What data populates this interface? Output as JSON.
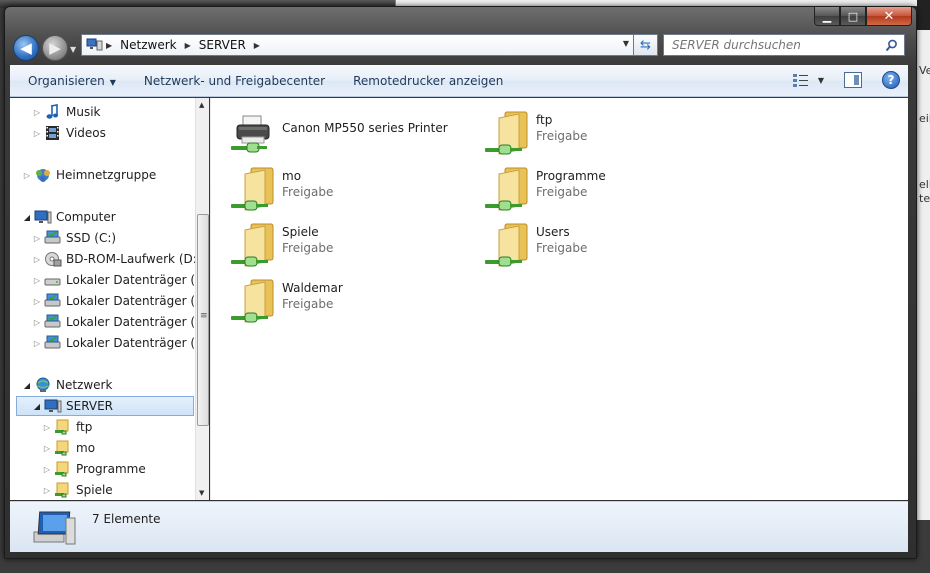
{
  "window": {
    "caption_buttons": {
      "minimize": "▁",
      "maximize": "□",
      "close": "✕"
    }
  },
  "address": {
    "crumbs": [
      "Netzwerk",
      "SERVER"
    ],
    "search_placeholder": "SERVER durchsuchen"
  },
  "toolbar": {
    "organize": "Organisieren",
    "network_center": "Netzwerk- und Freigabecenter",
    "remote_printers": "Remotedrucker anzeigen"
  },
  "nav": {
    "items": [
      {
        "label": "Musik",
        "icon": "music-icon",
        "toggle": "▷"
      },
      {
        "label": "Videos",
        "icon": "video-icon",
        "toggle": "▷"
      },
      {
        "label": "Heimnetzgruppe",
        "icon": "homegroup-icon",
        "toggle": "▷"
      },
      {
        "label": "Computer",
        "icon": "computer-icon",
        "toggle": "◢"
      },
      {
        "label": "SSD (C:)",
        "icon": "drive-icon",
        "toggle": "▷"
      },
      {
        "label": "BD-ROM-Laufwerk (D:) BD-ROM",
        "icon": "disc-icon",
        "toggle": "▷"
      },
      {
        "label": "Lokaler Datenträger (E:)",
        "icon": "drive-icon",
        "toggle": "▷"
      },
      {
        "label": "Lokaler Datenträger (X:)",
        "icon": "drive-icon",
        "toggle": "▷"
      },
      {
        "label": "Lokaler Datenträger (Y:)",
        "icon": "drive-icon",
        "toggle": "▷"
      },
      {
        "label": "Lokaler Datenträger (Z:)",
        "icon": "drive-icon",
        "toggle": "▷"
      },
      {
        "label": "Netzwerk",
        "icon": "network-icon",
        "toggle": "◢"
      },
      {
        "label": "SERVER",
        "icon": "computer-icon",
        "toggle": "◢"
      },
      {
        "label": "ftp",
        "icon": "share-folder-icon",
        "toggle": "▷"
      },
      {
        "label": "mo",
        "icon": "share-folder-icon",
        "toggle": "▷"
      },
      {
        "label": "Programme",
        "icon": "share-folder-icon",
        "toggle": "▷"
      },
      {
        "label": "Spiele",
        "icon": "share-folder-icon",
        "toggle": "▷"
      }
    ]
  },
  "content": {
    "items": [
      {
        "name": "Canon MP550 series Printer",
        "sub": "",
        "kind": "printer"
      },
      {
        "name": "ftp",
        "sub": "Freigabe",
        "kind": "share"
      },
      {
        "name": "mo",
        "sub": "Freigabe",
        "kind": "share"
      },
      {
        "name": "Programme",
        "sub": "Freigabe",
        "kind": "share"
      },
      {
        "name": "Spiele",
        "sub": "Freigabe",
        "kind": "share"
      },
      {
        "name": "Users",
        "sub": "Freigabe",
        "kind": "share"
      },
      {
        "name": "Waldemar",
        "sub": "Freigabe",
        "kind": "share"
      }
    ]
  },
  "status": {
    "count_text": "7 Elemente"
  },
  "background": {
    "right_snippets": [
      "Ve",
      "eib",
      "ell",
      "tel"
    ]
  }
}
